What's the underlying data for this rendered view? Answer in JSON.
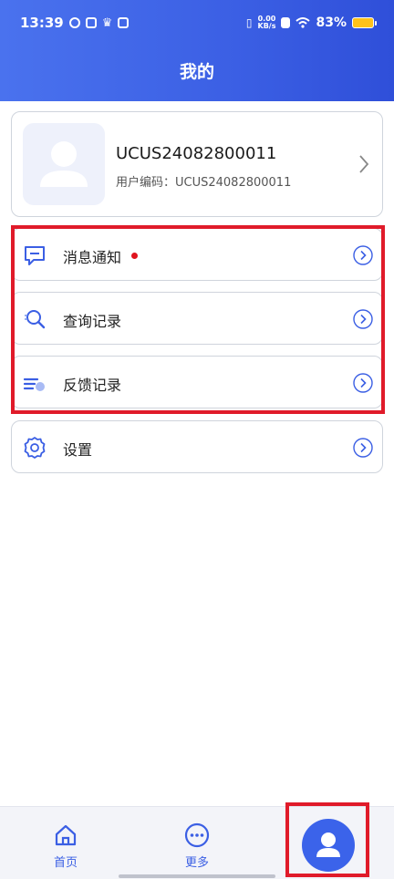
{
  "status_bar": {
    "time": "13:39",
    "net_speed_value": "0.00",
    "net_speed_unit": "KB/s",
    "battery": "83%"
  },
  "header": {
    "title": "我的"
  },
  "profile": {
    "name": "UCUS24082800011",
    "code_label": "用户编码：UCUS24082800011"
  },
  "menu": {
    "messages": {
      "label": "消息通知",
      "icon": "message-icon",
      "has_unread_dot": true
    },
    "query": {
      "label": "查询记录",
      "icon": "search-icon"
    },
    "feedback": {
      "label": "反馈记录",
      "icon": "feedback-icon"
    },
    "settings": {
      "label": "设置",
      "icon": "gear-icon"
    }
  },
  "bottom_nav": {
    "home": {
      "label": "首页",
      "icon": "home-icon"
    },
    "more": {
      "label": "更多",
      "icon": "more-icon"
    },
    "mine": {
      "icon": "user-icon",
      "active": true
    }
  },
  "colors": {
    "accent": "#3b5fe4",
    "highlight": "#e01b2a",
    "unread_dot": "#e0141e",
    "battery": "#ffc21a"
  }
}
